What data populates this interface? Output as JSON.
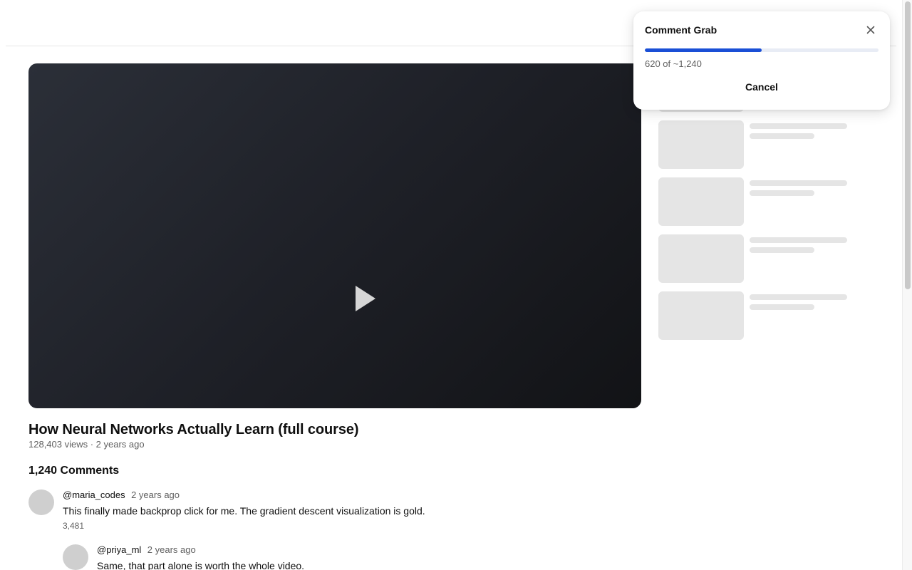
{
  "video": {
    "title": "How Neural Networks Actually Learn (full course)",
    "meta": "128,403 views · 2 years ago"
  },
  "comments": {
    "count_label": "1,240 Comments",
    "items": [
      {
        "author": "@maria_codes",
        "time": "2 years ago",
        "text": "This finally made backprop click for me. The gradient descent visualization is gold.",
        "likes": "3,481"
      },
      {
        "author": "@priya_ml",
        "time": "2 years ago",
        "text": "Same, that part alone is worth the whole video."
      }
    ]
  },
  "popup": {
    "title": "Comment Grab",
    "progress_text": "620 of ~1,240",
    "progress_fraction": 0.5,
    "cancel_label": "Cancel",
    "accent_color": "#1a4fd6"
  },
  "icons": {
    "play": "play-icon",
    "close": "close-icon"
  }
}
